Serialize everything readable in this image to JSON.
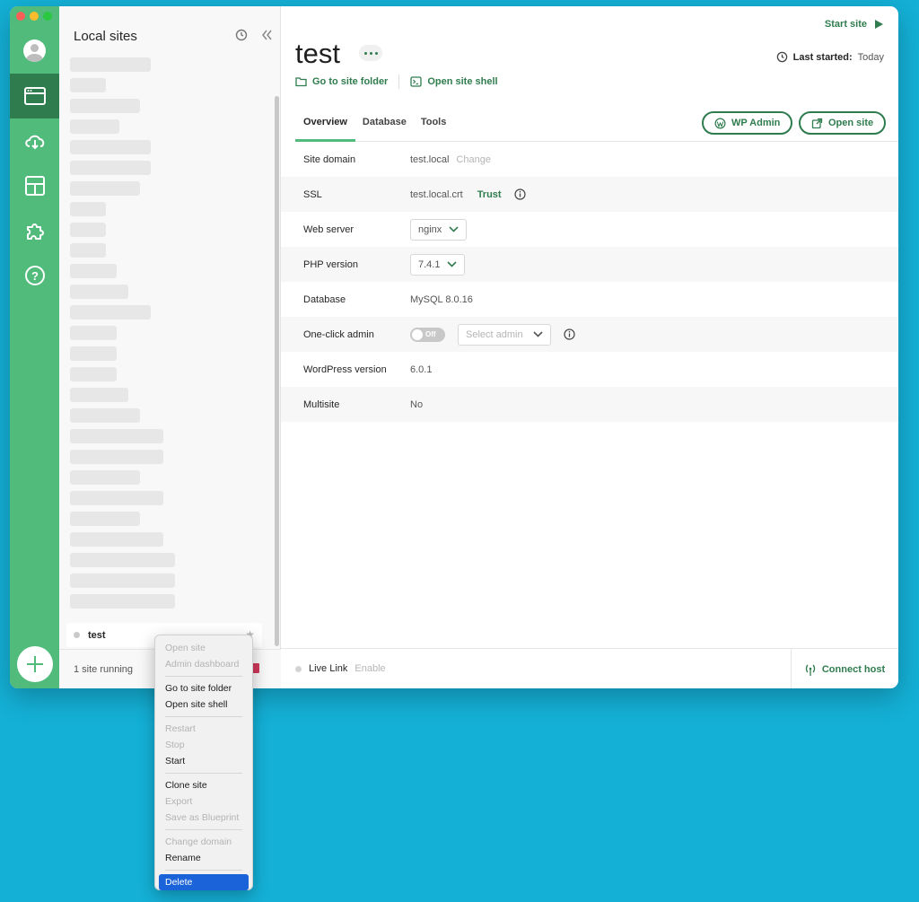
{
  "sidebar": {
    "title": "Local sites",
    "selected_site": "test",
    "running": "1 site running"
  },
  "site": {
    "name": "test",
    "start_label": "Start site",
    "last_started_label": "Last started:",
    "last_started_value": "Today",
    "go_folder": "Go to site folder",
    "open_shell": "Open site shell"
  },
  "tabs": [
    "Overview",
    "Database",
    "Tools"
  ],
  "actions": {
    "wp_admin": "WP Admin",
    "open_site": "Open site"
  },
  "overview": {
    "site_domain": {
      "label": "Site domain",
      "value": "test.local",
      "change": "Change"
    },
    "ssl": {
      "label": "SSL",
      "value": "test.local.crt",
      "trust": "Trust"
    },
    "web_server": {
      "label": "Web server",
      "value": "nginx"
    },
    "php": {
      "label": "PHP version",
      "value": "7.4.1"
    },
    "database": {
      "label": "Database",
      "value": "MySQL 8.0.16"
    },
    "one_click": {
      "label": "One-click admin",
      "toggle": "Off",
      "placeholder": "Select admin"
    },
    "wp_version": {
      "label": "WordPress version",
      "value": "6.0.1"
    },
    "multisite": {
      "label": "Multisite",
      "value": "No"
    }
  },
  "footer": {
    "live_link": "Live Link",
    "enable": "Enable",
    "connect_host": "Connect host"
  },
  "context_menu": {
    "items": [
      {
        "label": "Open site",
        "enabled": false
      },
      {
        "label": "Admin dashboard",
        "enabled": false
      },
      {
        "label": "Go to site folder",
        "enabled": true
      },
      {
        "label": "Open site shell",
        "enabled": true
      },
      {
        "label": "Restart",
        "enabled": false
      },
      {
        "label": "Stop",
        "enabled": false
      },
      {
        "label": "Start",
        "enabled": true
      },
      {
        "label": "Clone site",
        "enabled": true
      },
      {
        "label": "Export",
        "enabled": false
      },
      {
        "label": "Save as Blueprint",
        "enabled": false
      },
      {
        "label": "Change domain",
        "enabled": false
      },
      {
        "label": "Rename",
        "enabled": true
      },
      {
        "label": "Delete",
        "enabled": true,
        "selected": true
      }
    ]
  },
  "colors": {
    "brand_green": "#51bb7b",
    "dark_green": "#2f7c4e",
    "desktop": "#14b0d6",
    "menu_highlight": "#1a63d8",
    "stop_red": "#d0385b"
  }
}
